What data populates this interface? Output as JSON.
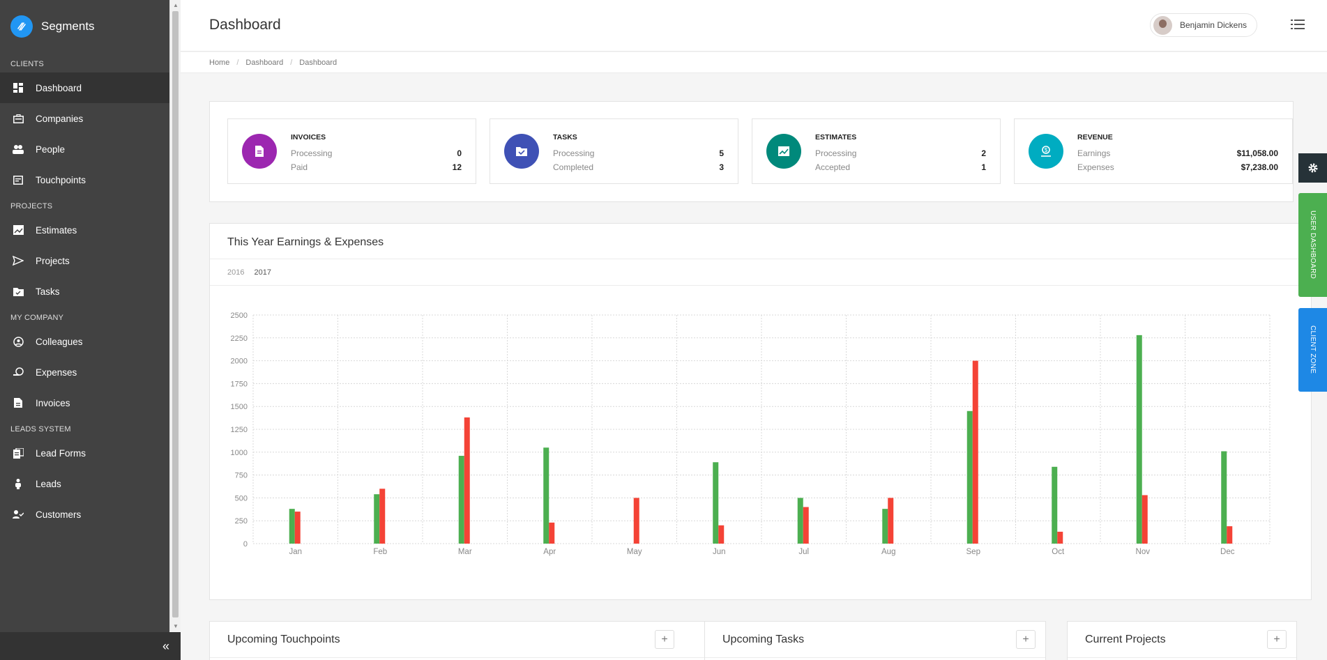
{
  "app": {
    "name": "Segments"
  },
  "header": {
    "title": "Dashboard",
    "user": "Benjamin Dickens"
  },
  "breadcrumb": [
    "Home",
    "Dashboard",
    "Dashboard"
  ],
  "sidebar": {
    "sections": [
      {
        "title": "CLIENTS",
        "items": [
          {
            "label": "Dashboard",
            "icon": "dashboard-icon",
            "active": true
          },
          {
            "label": "Companies",
            "icon": "companies-icon"
          },
          {
            "label": "People",
            "icon": "people-icon"
          },
          {
            "label": "Touchpoints",
            "icon": "touchpoints-icon"
          }
        ]
      },
      {
        "title": "PROJECTS",
        "items": [
          {
            "label": "Estimates",
            "icon": "estimates-icon"
          },
          {
            "label": "Projects",
            "icon": "projects-icon"
          },
          {
            "label": "Tasks",
            "icon": "tasks-icon"
          }
        ]
      },
      {
        "title": "MY COMPANY",
        "items": [
          {
            "label": "Colleagues",
            "icon": "colleagues-icon"
          },
          {
            "label": "Expenses",
            "icon": "expenses-icon"
          },
          {
            "label": "Invoices",
            "icon": "invoices-icon"
          }
        ]
      },
      {
        "title": "LEADS SYSTEM",
        "items": [
          {
            "label": "Lead Forms",
            "icon": "lead-forms-icon"
          },
          {
            "label": "Leads",
            "icon": "leads-icon"
          },
          {
            "label": "Customers",
            "icon": "customers-icon"
          }
        ]
      }
    ]
  },
  "stats": [
    {
      "title": "INVOICES",
      "color": "#9c27b0",
      "icon": "invoice-icon",
      "rows": [
        {
          "label": "Processing",
          "value": "0"
        },
        {
          "label": "Paid",
          "value": "12"
        }
      ]
    },
    {
      "title": "TASKS",
      "color": "#3f51b5",
      "icon": "tasks-folder-icon",
      "rows": [
        {
          "label": "Processing",
          "value": "5"
        },
        {
          "label": "Completed",
          "value": "3"
        }
      ]
    },
    {
      "title": "ESTIMATES",
      "color": "#00897b",
      "icon": "estimates-chart-icon",
      "rows": [
        {
          "label": "Processing",
          "value": "2"
        },
        {
          "label": "Accepted",
          "value": "1"
        }
      ]
    },
    {
      "title": "REVENUE",
      "color": "#00acc1",
      "icon": "revenue-icon",
      "rows": [
        {
          "label": "Earnings",
          "value": "$11,058.00"
        },
        {
          "label": "Expenses",
          "value": "$7,238.00"
        }
      ]
    }
  ],
  "chart_section": {
    "title": "This Year Earnings & Expenses",
    "years": [
      "2016",
      "2017"
    ],
    "selected_year": "2017"
  },
  "chart_data": {
    "type": "bar",
    "categories": [
      "Jan",
      "Feb",
      "Mar",
      "Apr",
      "May",
      "Jun",
      "Jul",
      "Aug",
      "Sep",
      "Oct",
      "Nov",
      "Dec"
    ],
    "series": [
      {
        "color": "#4caf50",
        "values": [
          380,
          540,
          960,
          1050,
          0,
          890,
          500,
          380,
          1450,
          840,
          2280,
          1010
        ]
      },
      {
        "color": "#f44336",
        "values": [
          350,
          600,
          1380,
          230,
          500,
          200,
          400,
          500,
          2000,
          130,
          530,
          190
        ]
      }
    ],
    "yticks": [
      0,
      250,
      500,
      750,
      1000,
      1250,
      1500,
      1750,
      2000,
      2250,
      2500
    ],
    "ylim": [
      0,
      2500
    ],
    "grid": true
  },
  "side_tabs": {
    "user_dashboard": "USER DASHBOARD",
    "client_zone": "CLIENT ZONE"
  },
  "panels": [
    {
      "title": "Upcoming Touchpoints"
    },
    {
      "title": "Upcoming Tasks"
    },
    {
      "title": "Current Projects"
    }
  ]
}
